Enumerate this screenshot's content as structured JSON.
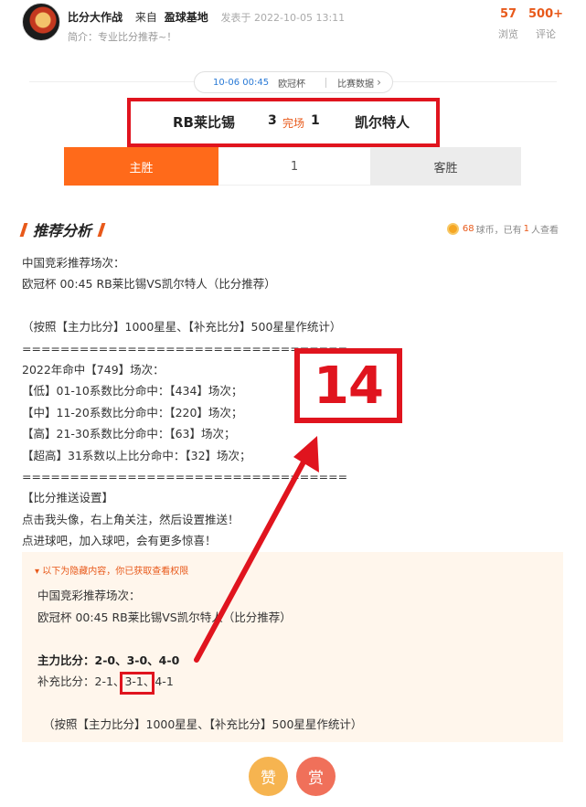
{
  "header": {
    "author": "比分大作战",
    "from_label": "来自",
    "source": "盈球基地",
    "posted": "发表于 2022-10-05 13:11",
    "intro": "简介：专业比分推荐~！",
    "views_count": "57",
    "views_label": "浏览",
    "comments_count": "500+",
    "comments_label": "评论"
  },
  "match_pill": {
    "date": "10-06 00:45",
    "competition": "欧冠杯",
    "data_link": "比赛数据"
  },
  "match": {
    "home_team": "RB莱比锡",
    "home_score": "3",
    "status": "完场",
    "away_score": "1",
    "away_team": "凯尔特人"
  },
  "result_bar": {
    "home": "主胜",
    "draw": "1",
    "away": "客胜"
  },
  "section": {
    "title": "推荐分析",
    "coins": "68",
    "coins_unit": "球币，已有",
    "viewers": "1",
    "viewers_unit": "人查看"
  },
  "content_lines": [
    "中国竞彩推荐场次：",
    "欧冠杯  00:45  RB莱比锡VS凯尔特人（比分推荐）",
    "",
    "（按照【主力比分】1000星星、【补充比分】500星星作统计）",
    "==================================",
    "2022年命中【749】场次：",
    "【低】01-10系数比分命中：【434】场次；",
    "【中】11-20系数比分命中：【220】场次；",
    "【高】21-30系数比分命中：【63】场次；",
    "【超高】31系数以上比分命中：【32】场次；",
    "==================================",
    "【比分推送设置】",
    "点击我头像，右上角关注，然后设置推送！",
    "点进球吧，加入球吧，会有更多惊喜！"
  ],
  "hidden": {
    "hint": "以下为隐藏内容，你已获取查看权限",
    "line1": "中国竞彩推荐场次：",
    "line2": "欧冠杯  00:45  RB莱比锡VS凯尔特人（比分推荐）",
    "main_label": "主力比分：",
    "main_scores": "2-0、3-0、4-0",
    "extra_label": "补充比分：",
    "extra_a": "2-1、",
    "extra_b": "3-1、",
    "extra_c": "4-1",
    "note": "（按照【主力比分】1000星星、【补充比分】500星星作统计）"
  },
  "annotation": {
    "number": "14",
    "color": "#e0141e"
  },
  "buttons": {
    "like": "赞",
    "reward": "赏"
  }
}
